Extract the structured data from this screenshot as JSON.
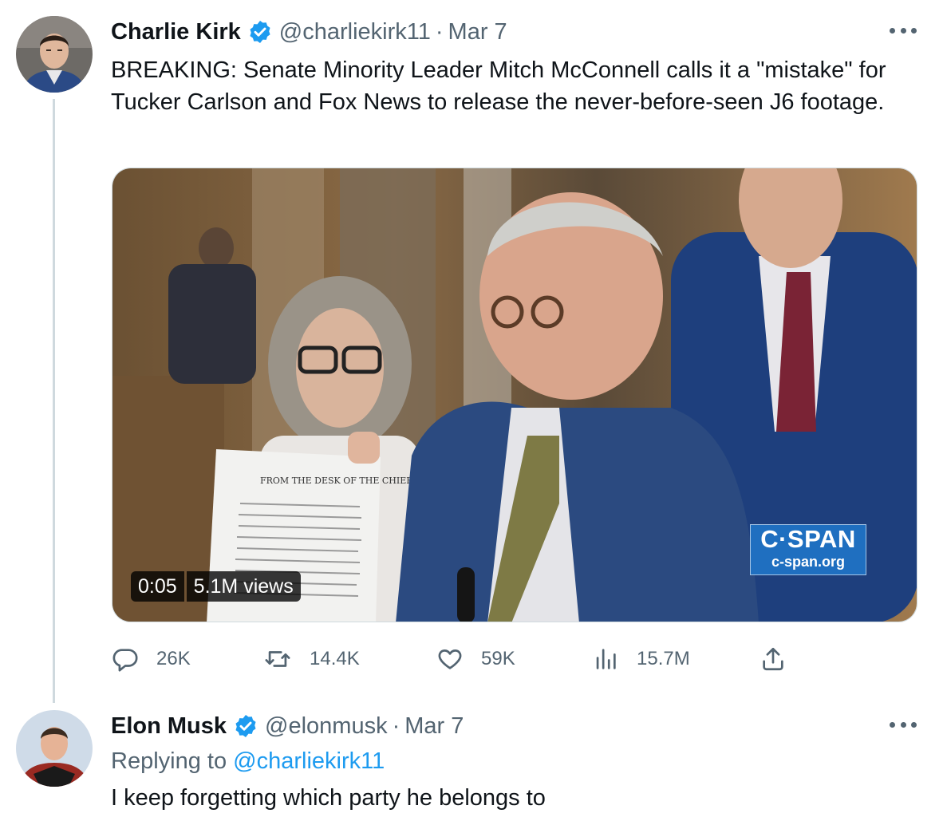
{
  "tweet": {
    "author_name": "Charlie Kirk",
    "handle": "@charliekirk11",
    "separator": "·",
    "date": "Mar 7",
    "text": "BREAKING: Senate Minority Leader Mitch McConnell calls it a \"mistake\" for Tucker Carlson and Fox News to release the never-before-seen J6 footage.",
    "video": {
      "duration": "0:05",
      "views": "5.1M views",
      "watermark_logo": "C·SPAN",
      "watermark_url": "c-span.org",
      "document_heading": "FROM THE DESK OF THE CHIEF"
    },
    "actions": {
      "replies": "26K",
      "retweets": "14.4K",
      "likes": "59K",
      "views": "15.7M"
    }
  },
  "reply": {
    "author_name": "Elon Musk",
    "handle": "@elonmusk",
    "separator": "·",
    "date": "Mar 7",
    "replying_prefix": "Replying to",
    "replying_to": "@charliekirk11",
    "text": "I keep forgetting which party he belongs to"
  },
  "icons": {
    "verified": "verified-badge-icon",
    "more": "more-options-icon",
    "reply": "reply-icon",
    "retweet": "retweet-icon",
    "like": "heart-icon",
    "views": "views-chart-icon",
    "share": "share-icon"
  },
  "colors": {
    "accent": "#1d9bf0",
    "text_primary": "#0f1419",
    "text_secondary": "#536471",
    "border": "#cfd9de",
    "cspan_blue": "#1f6fc0"
  }
}
